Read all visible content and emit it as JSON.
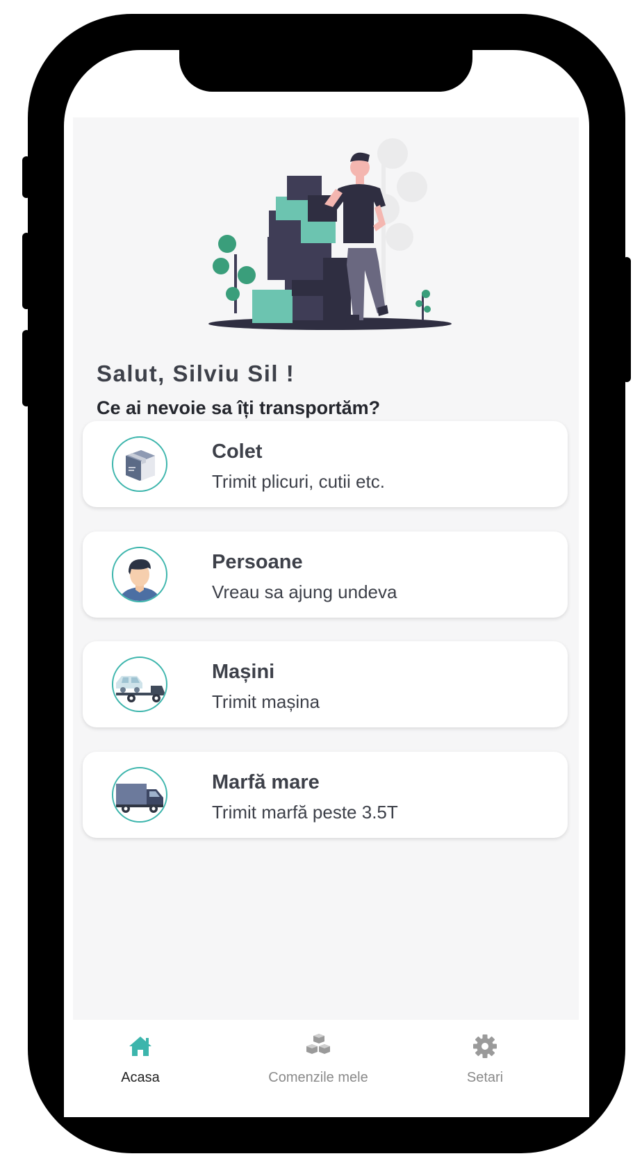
{
  "greeting": "Salut, Silviu Sil !",
  "question": "Ce ai nevoie sa îți transportăm?",
  "services": [
    {
      "title": "Colet",
      "subtitle": "Trimit plicuri, cutii etc.",
      "icon": "parcel-box-icon"
    },
    {
      "title": "Persoane",
      "subtitle": "Vreau sa ajung undeva",
      "icon": "person-avatar-icon"
    },
    {
      "title": "Mașini",
      "subtitle": "Trimit mașina",
      "icon": "car-tow-truck-icon"
    },
    {
      "title": "Marfă mare",
      "subtitle": "Trimit marfă peste 3.5T",
      "icon": "truck-icon"
    }
  ],
  "tabbar": {
    "items": [
      {
        "label": "Acasa",
        "icon": "home-icon",
        "active": true
      },
      {
        "label": "Comenzile mele",
        "icon": "boxes-icon",
        "active": false
      },
      {
        "label": "Setari",
        "icon": "gear-icon",
        "active": false
      }
    ]
  },
  "colors": {
    "accent": "#3cb5ac",
    "text_dark": "#3d4049",
    "tab_inactive": "#8a8a8a",
    "background": "#f6f6f7"
  }
}
